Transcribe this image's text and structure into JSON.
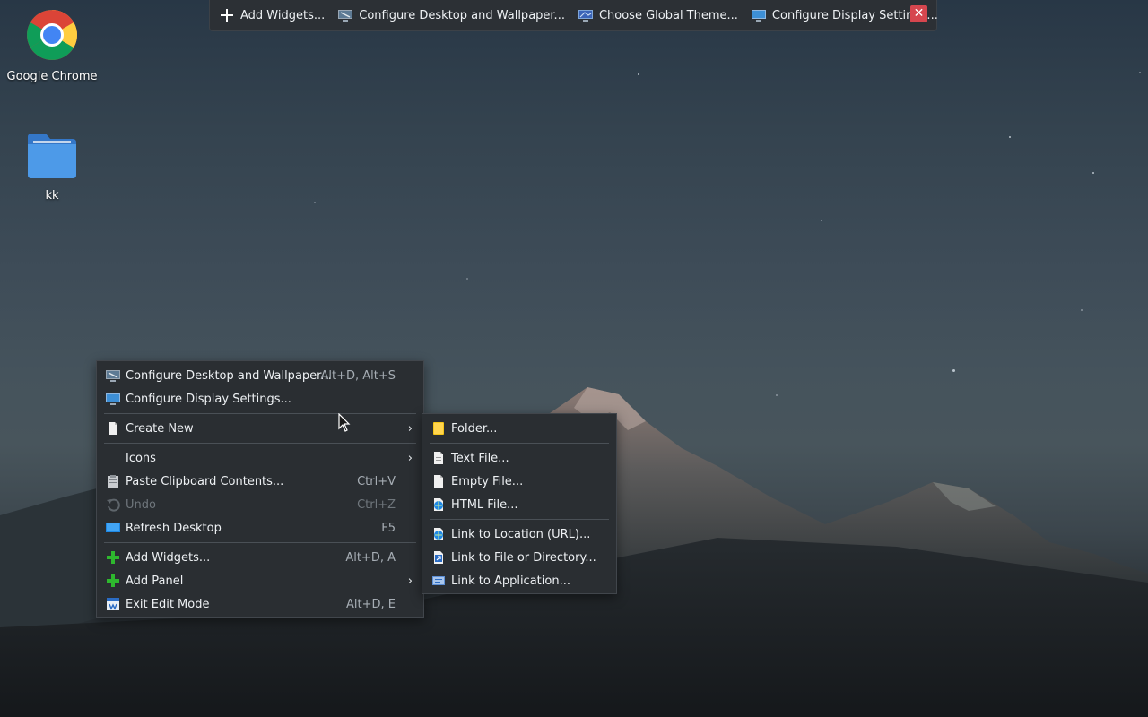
{
  "desktop_icons": [
    {
      "label": "Google Chrome",
      "icon": "chrome-icon"
    },
    {
      "label": "kk",
      "icon": "folder-icon"
    }
  ],
  "toolbar": {
    "add_widgets": "Add Widgets...",
    "configure_desktop": "Configure Desktop and Wallpaper...",
    "global_theme": "Choose Global Theme...",
    "display_settings": "Configure Display Settings...",
    "close_icon": "close-icon"
  },
  "context_menu": {
    "configure_desktop": {
      "label": "Configure Desktop and Wallpaper...",
      "shortcut": "Alt+D, Alt+S"
    },
    "configure_display": {
      "label": "Configure Display Settings..."
    },
    "create_new": {
      "label": "Create New"
    },
    "icons": {
      "label": "Icons"
    },
    "paste": {
      "label": "Paste Clipboard Contents...",
      "shortcut": "Ctrl+V"
    },
    "undo": {
      "label": "Undo",
      "shortcut": "Ctrl+Z"
    },
    "refresh": {
      "label": "Refresh Desktop",
      "shortcut": "F5"
    },
    "add_widgets": {
      "label": "Add Widgets...",
      "shortcut": "Alt+D, A"
    },
    "add_panel": {
      "label": "Add Panel"
    },
    "exit_edit": {
      "label": "Exit Edit Mode",
      "shortcut": "Alt+D, E"
    }
  },
  "submenu": {
    "folder": "Folder...",
    "text_file": "Text File...",
    "empty_file": "Empty File...",
    "html_file": "HTML File...",
    "link_url": "Link to Location (URL)...",
    "link_file": "Link to File or Directory...",
    "link_app": "Link to Application..."
  },
  "colors": {
    "menu_bg": "#2a2e32",
    "accent_green": "#2eb82e",
    "close_red": "#d6464e",
    "folder_blue": "#3d8fe0"
  }
}
